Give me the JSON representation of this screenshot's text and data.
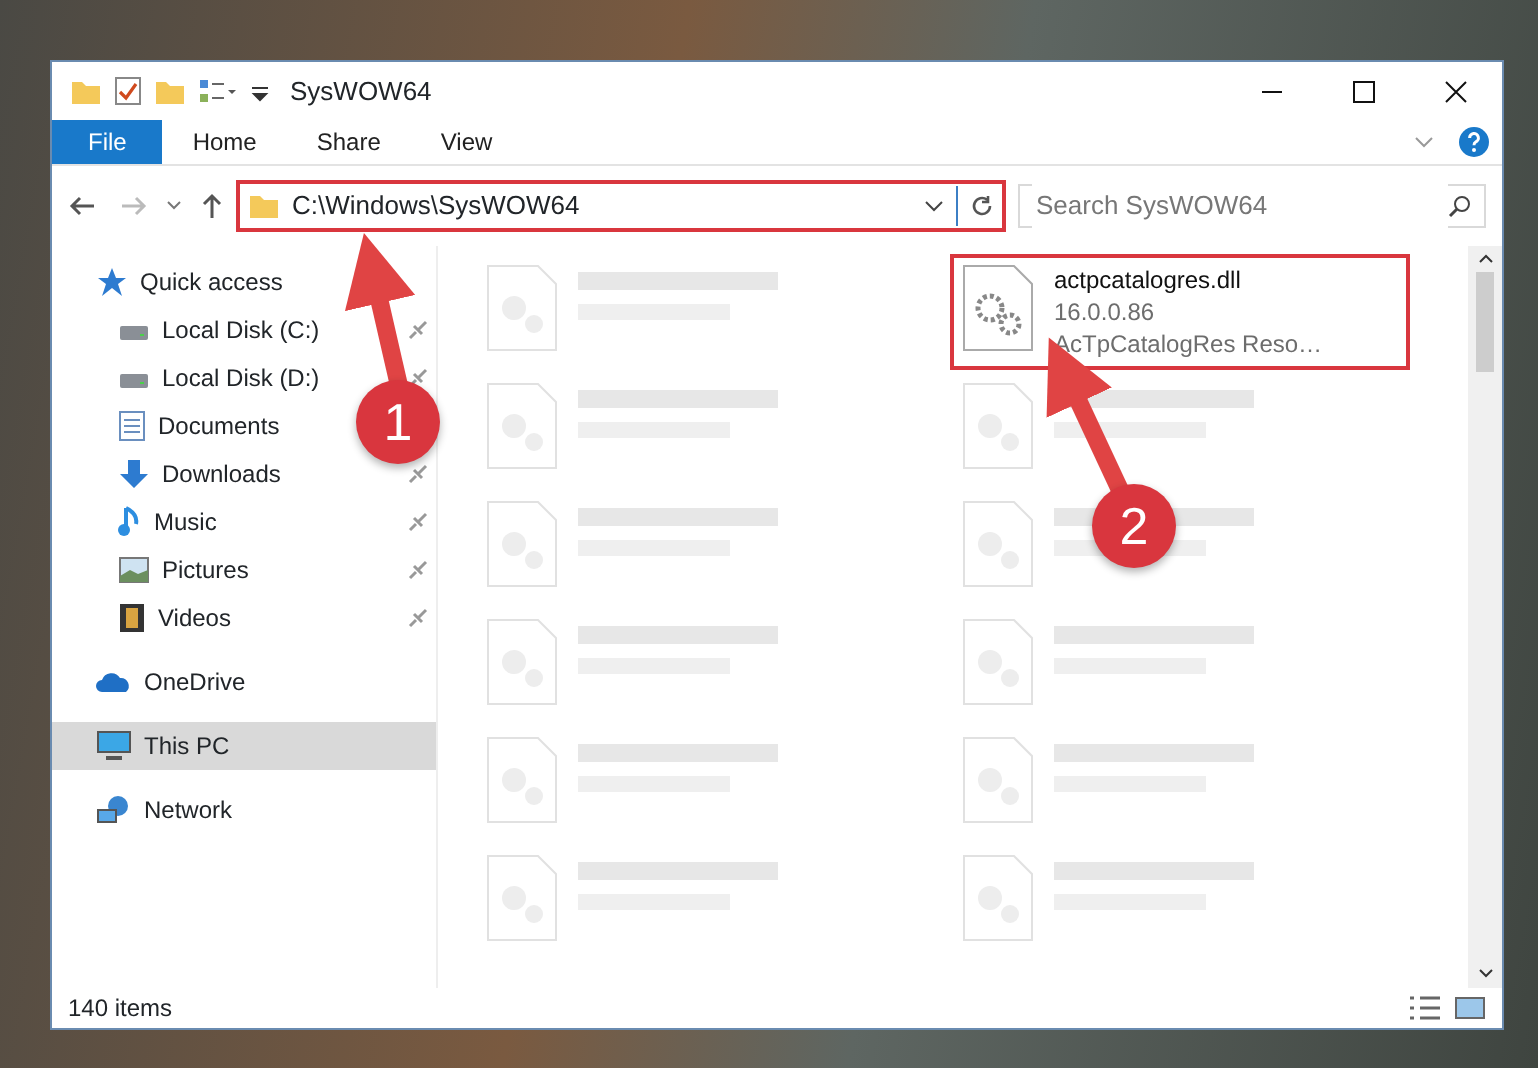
{
  "window": {
    "title": "SysWOW64"
  },
  "ribbon_tabs": [
    {
      "label": "File",
      "kind": "file"
    },
    {
      "label": "Home",
      "kind": "tab"
    },
    {
      "label": "Share",
      "kind": "tab"
    },
    {
      "label": "View",
      "kind": "tab"
    }
  ],
  "address": {
    "path": "C:\\Windows\\SysWOW64",
    "highlighted": true
  },
  "search": {
    "placeholder": "Search SysWOW64"
  },
  "sidebar": {
    "items": [
      {
        "label": "Quick access",
        "kind": "star",
        "selected": false,
        "children": [
          {
            "label": "Local Disk (C:)",
            "kind": "drive",
            "pinned": true,
            "selected": false
          },
          {
            "label": "Local Disk (D:)",
            "kind": "drive",
            "pinned": true,
            "selected": false
          },
          {
            "label": "Documents",
            "kind": "document",
            "selected": false
          },
          {
            "label": "Downloads",
            "kind": "download",
            "pinned": true,
            "selected": false
          },
          {
            "label": "Music",
            "kind": "music",
            "pinned": true,
            "selected": false
          },
          {
            "label": "Pictures",
            "kind": "picture",
            "pinned": true,
            "selected": false
          },
          {
            "label": "Videos",
            "kind": "video",
            "pinned": true,
            "selected": false
          }
        ]
      },
      {
        "label": "OneDrive",
        "kind": "cloud",
        "selected": false
      },
      {
        "label": "This PC",
        "kind": "computer",
        "selected": true
      },
      {
        "label": "Network",
        "kind": "network",
        "selected": false
      }
    ]
  },
  "files": [
    {
      "kind": "blurred"
    },
    {
      "kind": "file",
      "name": "actpcatalogres.dll",
      "details": [
        "16.0.0.86",
        "AcTpCatalogRes Reso…"
      ],
      "highlighted": true
    },
    {
      "kind": "blurred"
    },
    {
      "kind": "blurred"
    },
    {
      "kind": "blurred"
    },
    {
      "kind": "blurred"
    },
    {
      "kind": "blurred"
    },
    {
      "kind": "blurred"
    },
    {
      "kind": "blurred"
    },
    {
      "kind": "blurred"
    },
    {
      "kind": "blurred"
    },
    {
      "kind": "blurred"
    }
  ],
  "status_bar": {
    "count": "140 items"
  },
  "annotations": [
    {
      "number": "1"
    },
    {
      "number": "2"
    }
  ]
}
